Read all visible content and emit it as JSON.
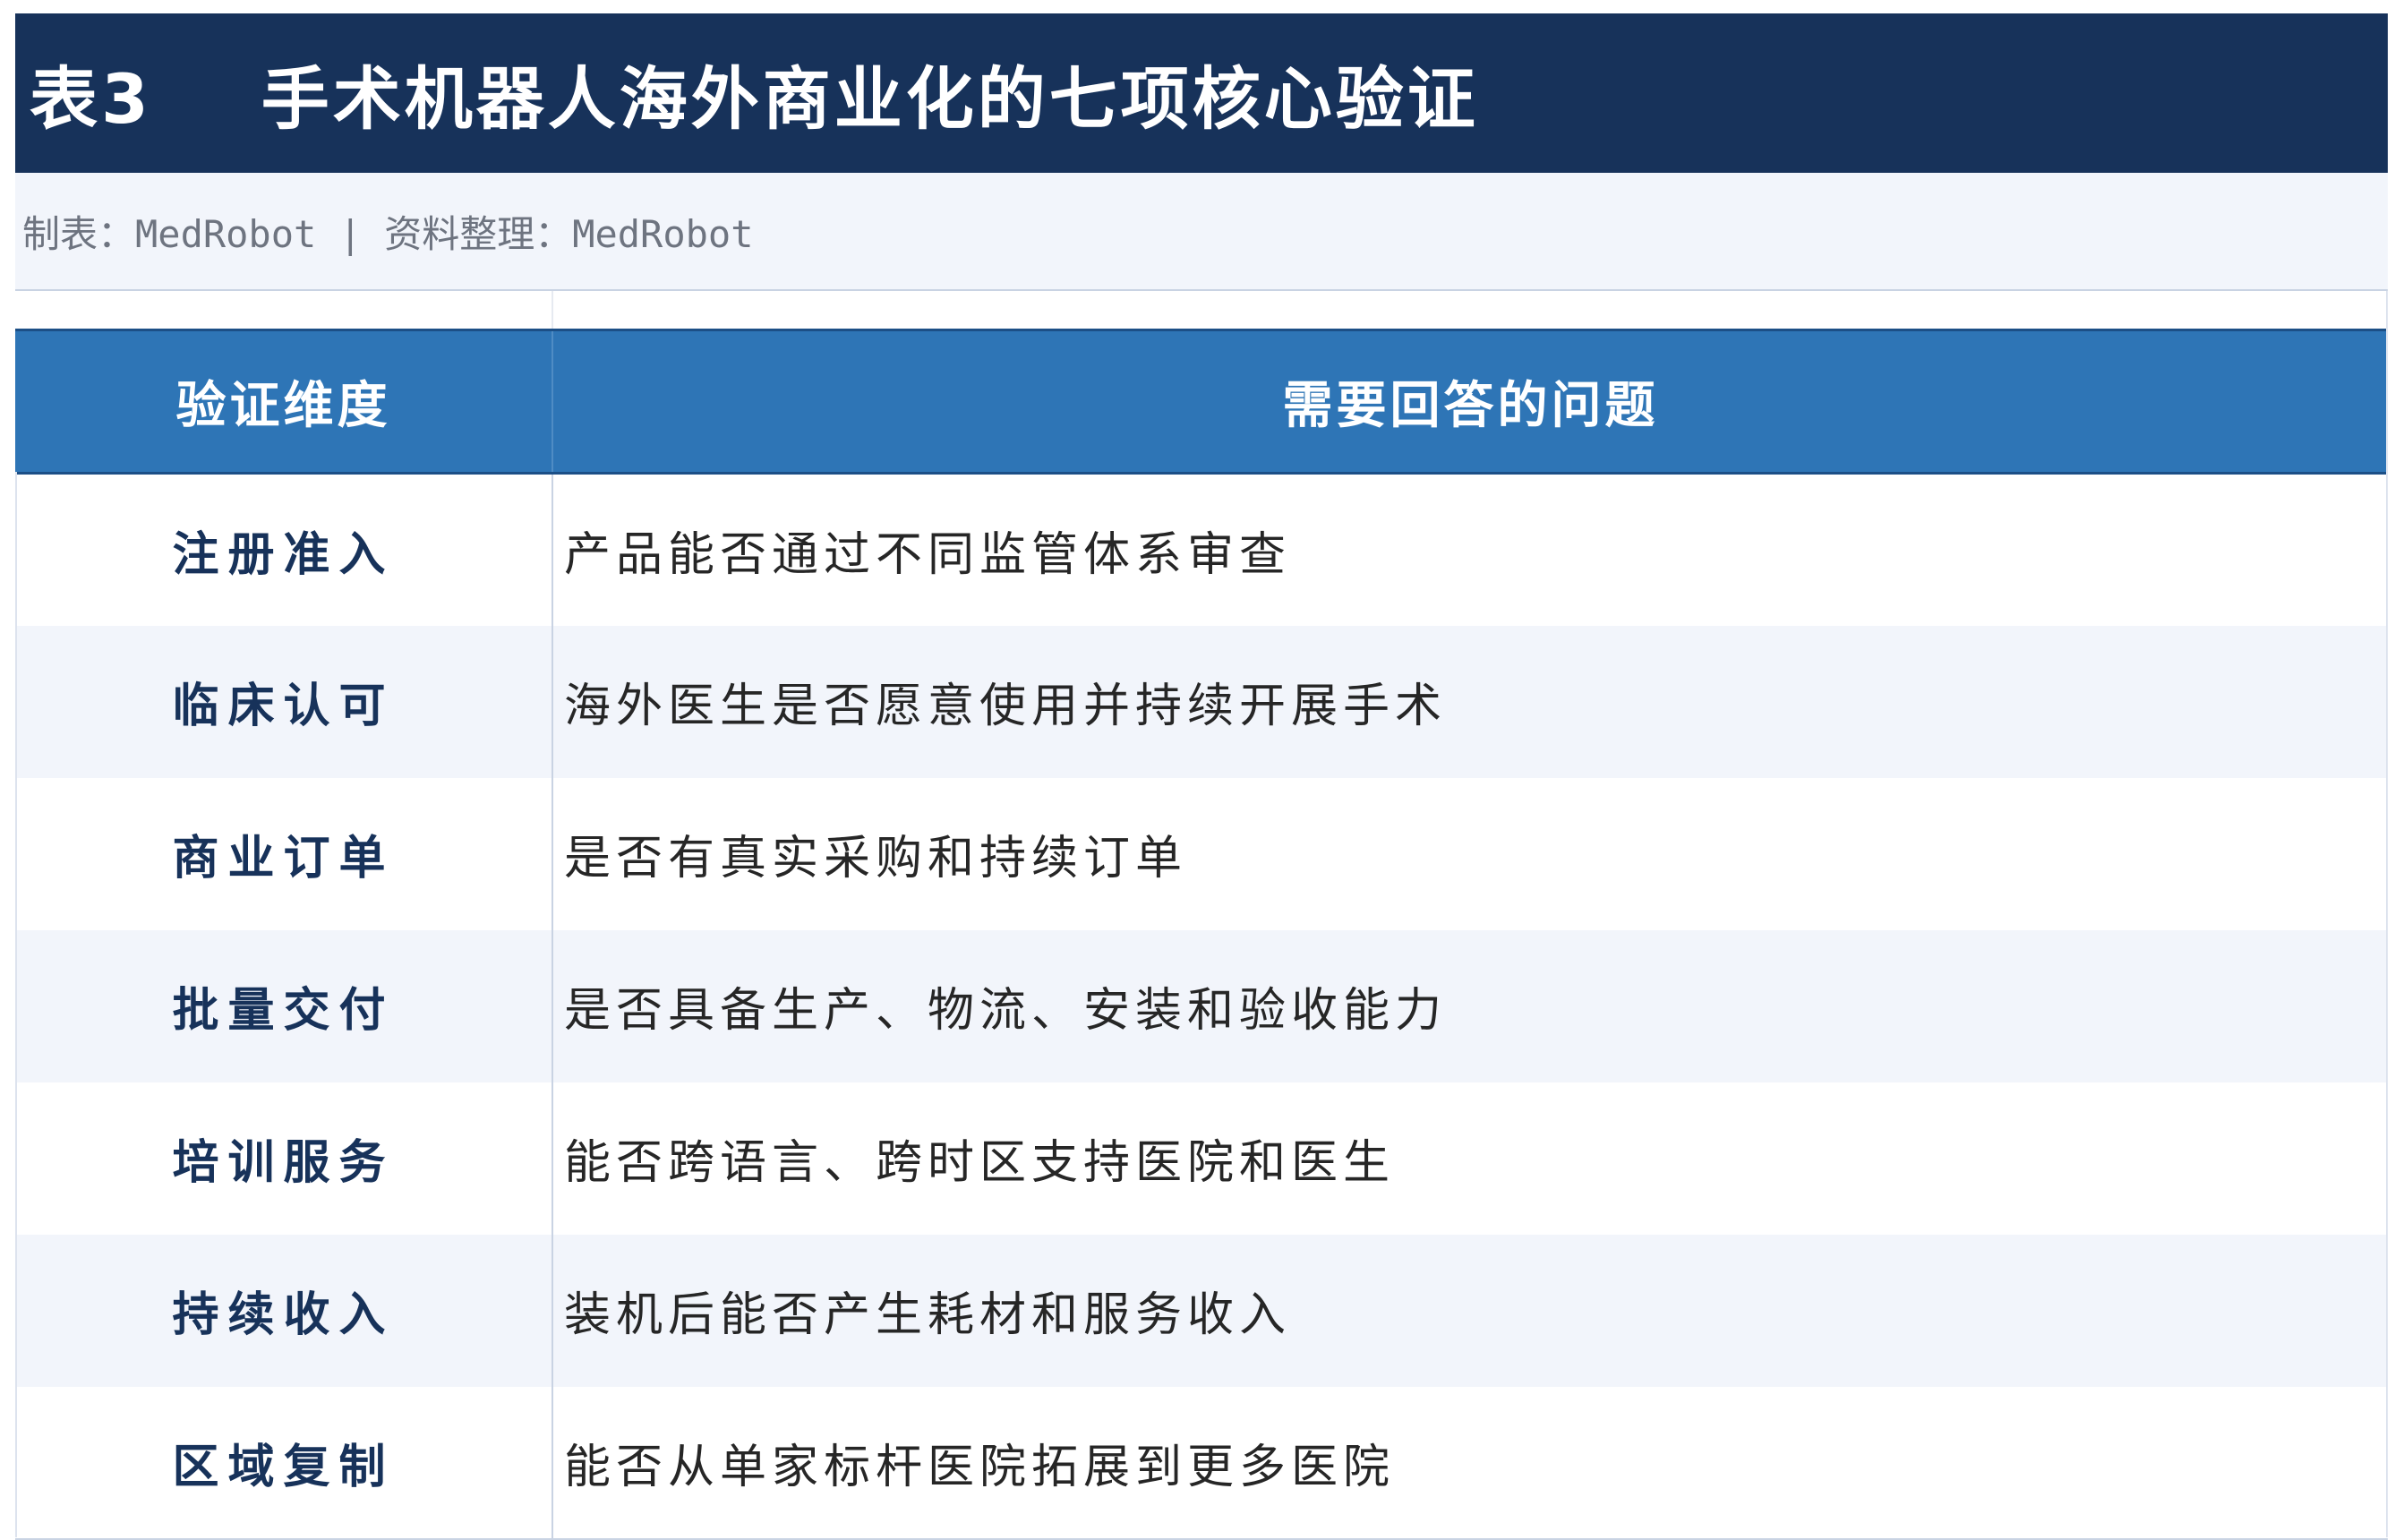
{
  "title": {
    "label": "表3",
    "text": "手术机器人海外商业化的七项核心验证"
  },
  "source": {
    "made_by": "制表：MedRobot",
    "separator": "|",
    "data_by": "资料整理：MedRobot"
  },
  "table": {
    "headers": {
      "dimension": "验证维度",
      "question": "需要回答的问题"
    },
    "rows": [
      {
        "dimension": "注册准入",
        "question": "产品能否通过不同监管体系审查"
      },
      {
        "dimension": "临床认可",
        "question": "海外医生是否愿意使用并持续开展手术"
      },
      {
        "dimension": "商业订单",
        "question": "是否有真实采购和持续订单"
      },
      {
        "dimension": "批量交付",
        "question": "是否具备生产、物流、安装和验收能力"
      },
      {
        "dimension": "培训服务",
        "question": "能否跨语言、跨时区支持医院和医生"
      },
      {
        "dimension": "持续收入",
        "question": "装机后能否产生耗材和服务收入"
      },
      {
        "dimension": "区域复制",
        "question": "能否从单家标杆医院拓展到更多医院"
      }
    ]
  },
  "colors": {
    "title_background": "#17325a",
    "header_background": "#2e75b6",
    "alt_row_background": "#f2f5fb",
    "dimension_text": "#17325a",
    "body_text": "#262626",
    "source_text": "#6e7480"
  }
}
